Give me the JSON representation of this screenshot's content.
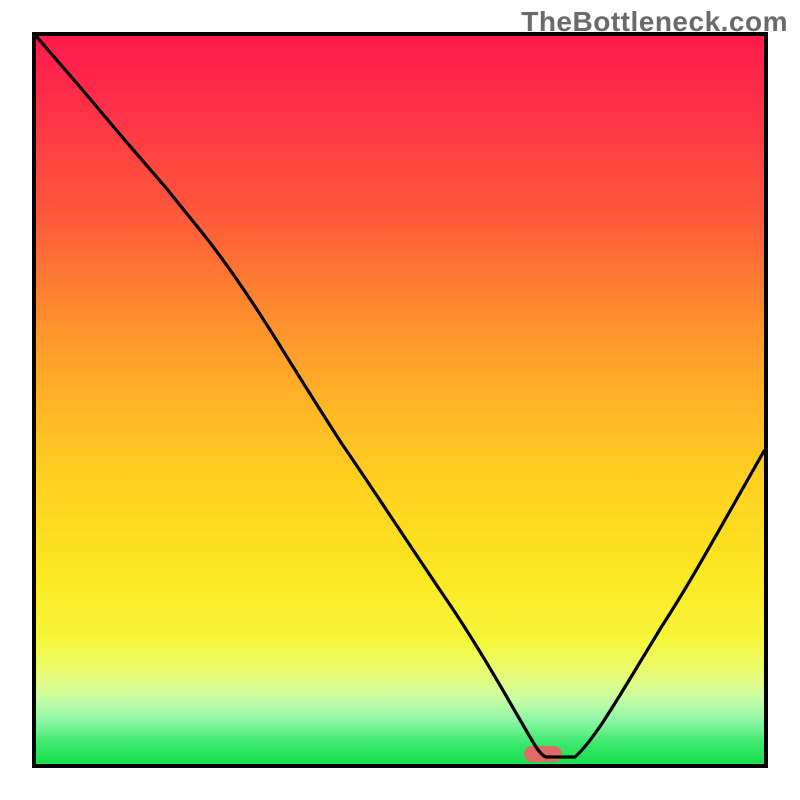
{
  "watermark": "TheBottleneck.com",
  "chart_data": {
    "type": "line",
    "title": "",
    "xlabel": "",
    "ylabel": "",
    "xlim": [
      0,
      100
    ],
    "ylim": [
      0,
      100
    ],
    "grid": false,
    "legend": false,
    "background": "rainbow-gradient-red-to-green",
    "marker": {
      "x": 70,
      "y": 1,
      "shape": "capsule",
      "color": "#e06a6a"
    },
    "series": [
      {
        "name": "bottleneck-curve",
        "x": [
          0,
          6,
          12,
          18,
          24,
          30,
          36,
          42,
          50,
          56,
          62,
          66,
          70,
          74,
          80,
          86,
          92,
          100
        ],
        "values": [
          100,
          93,
          86,
          79,
          72,
          63,
          53,
          44,
          32,
          23,
          14,
          7,
          1,
          1,
          9,
          19,
          29,
          43
        ]
      }
    ],
    "notes": "Single black curve on a vertical red→green gradient. Curve starts at top-left, descends to a minimum near x≈70 where a pink capsule marker sits at the bottom edge, then rises toward the right edge. No axis ticks or labels visible besides the watermark."
  }
}
